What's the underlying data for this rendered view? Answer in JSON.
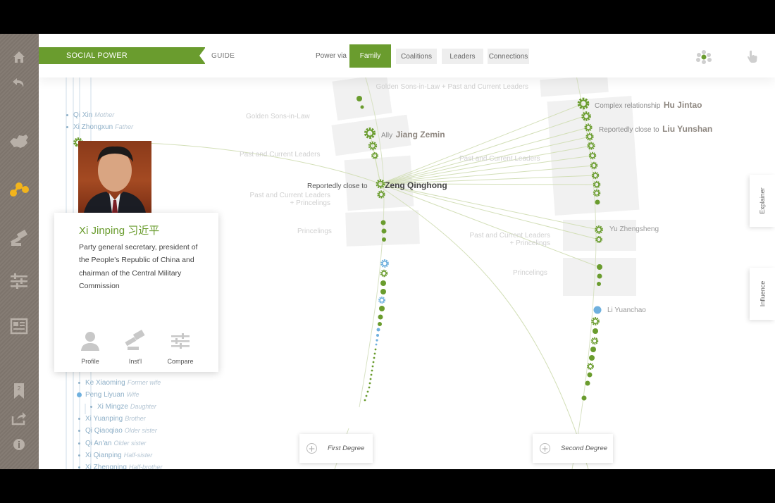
{
  "app": {
    "section_title": "SOCIAL POWER",
    "guide_label": "GUIDE",
    "power_via_label": "Power via",
    "tabs": [
      "Family",
      "Coalitions",
      "Leaders",
      "Connections"
    ],
    "active_tab": "Family",
    "right_tabs": [
      "Explainer",
      "Influence"
    ],
    "bookmark_count": "2"
  },
  "colors": {
    "accent": "#6a9c2e",
    "node_blue": "#6fb0de",
    "sidebar": "#7d746c"
  },
  "sidebar_icons": [
    "home-icon",
    "back-icon",
    "china-map-icon",
    "network-icon",
    "gavel-icon",
    "sliders-icon",
    "newspaper-icon",
    "bookmark-icon",
    "share-icon",
    "info-icon"
  ],
  "family_top": [
    {
      "name": "Qi Xin",
      "relation": "Mother"
    },
    {
      "name": "Xi Zhongxun",
      "relation": "Father"
    }
  ],
  "family_bottom": [
    {
      "name": "Ke Xiaoming",
      "relation": "Former wife"
    },
    {
      "name": "Peng Liyuan",
      "relation": "Wife"
    },
    {
      "name": "Xi Mingze",
      "relation": "Daughter"
    },
    {
      "name": "Xi Yuanping",
      "relation": "Brother"
    },
    {
      "name": "Qi Qiaoqiao",
      "relation": "Older sister"
    },
    {
      "name": "Qi An'an",
      "relation": "Older sister"
    },
    {
      "name": "Xi Qianping",
      "relation": "Half-sister"
    },
    {
      "name": "Xi Zhengning",
      "relation": "Half-brother"
    }
  ],
  "profile": {
    "name": "Xi Jinping 习近平",
    "description": "Party general secretary, president of the People's Republic of China and chairman of the Central Military Commission",
    "actions": [
      "Profile",
      "Inst'l",
      "Compare"
    ]
  },
  "graph": {
    "groups": {
      "golden_sons_in_law_plus_leaders": "Golden Sons-in-Law + Past and Current Leaders",
      "golden_sons_in_law": "Golden Sons-in-Law",
      "past_current_leaders_1": "Past and Current Leaders",
      "past_current_leaders_2": "Past and Current Leaders",
      "leaders_princelings_1": "Past and Current Leaders + Princelings",
      "princelings_1": "Princelings",
      "leaders_princelings_2": "Past and Current Leaders + Princelings",
      "princelings_2": "Princelings"
    },
    "people": {
      "hu_jintao": {
        "prefix": "Complex relationship",
        "name": "Hu Jintao"
      },
      "liu_yunshan": {
        "prefix": "Reportedly close to",
        "name": "Liu Yunshan"
      },
      "jiang_zemin": {
        "prefix": "Ally",
        "name": "Jiang Zemin"
      },
      "zeng_qinghong": {
        "prefix": "Reportedly close to",
        "name": "Zeng Qinghong"
      },
      "yu_zhengsheng": {
        "name": "Yu Zhengsheng"
      },
      "li_yuanchao": {
        "name": "Li Yuanchao"
      }
    }
  },
  "degree_buttons": [
    "First Degree",
    "Second Degree"
  ]
}
